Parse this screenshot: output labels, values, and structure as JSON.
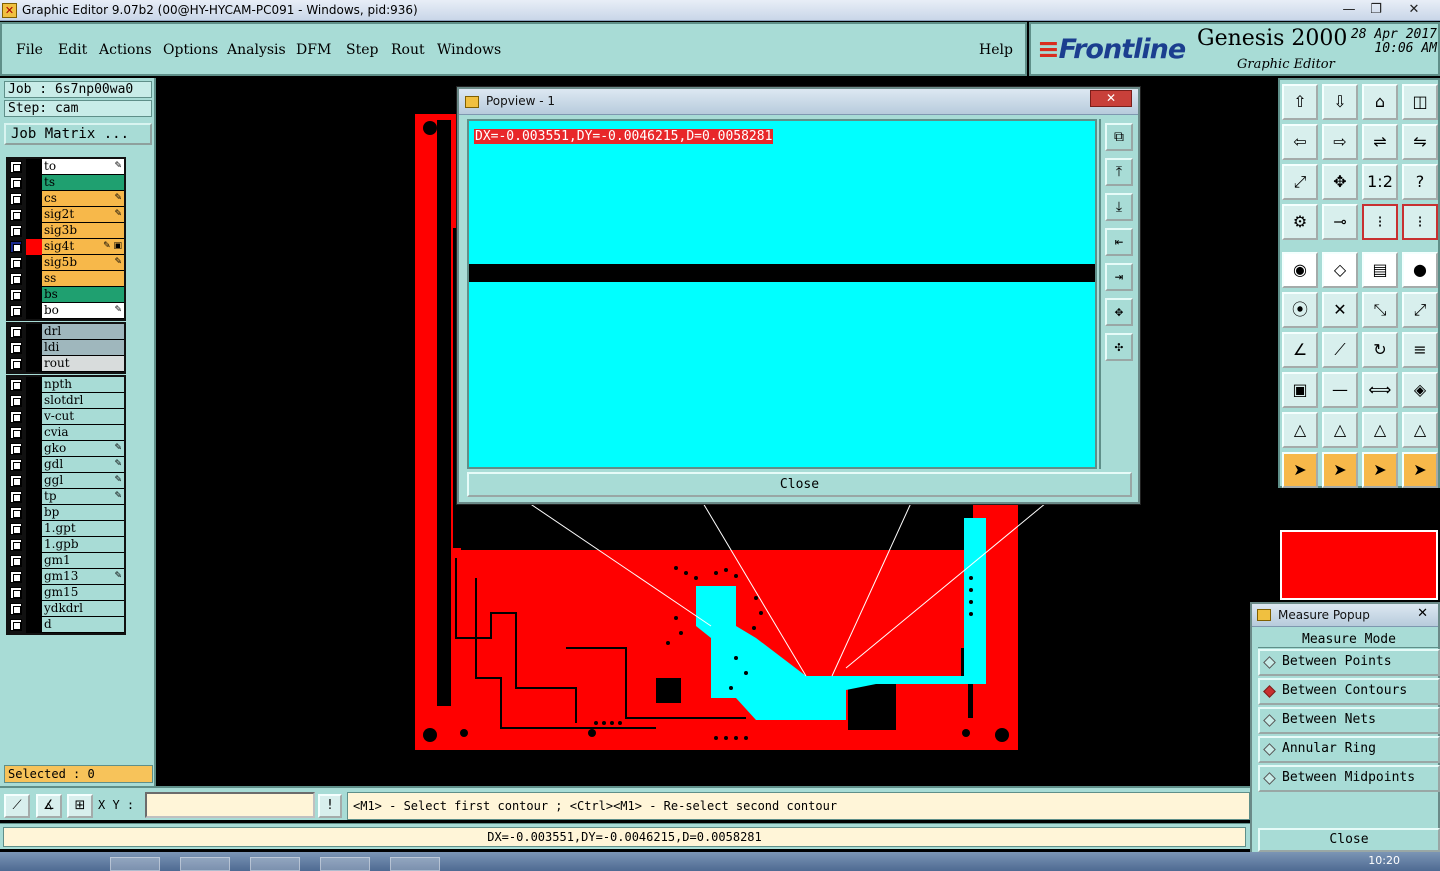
{
  "window": {
    "title": "Graphic Editor 9.07b2 (00@HY-HYCAM-PC091 - Windows, pid:936)",
    "minimize": "—",
    "maximize": "❐",
    "close": "✕"
  },
  "menu": {
    "items": [
      "File",
      "Edit",
      "Actions",
      "Options",
      "Analysis",
      "DFM",
      "Step",
      "Rout",
      "Windows"
    ],
    "help": "Help"
  },
  "brand": {
    "logo": "Frontline",
    "product": "Genesis 2000",
    "subtitle": "Graphic Editor",
    "date": "28 Apr 2017",
    "time": "10:06 AM"
  },
  "job": {
    "job_label": "Job : 6s7np00wa0",
    "step_label": "Step: cam",
    "matrix_button": "Job Matrix ..."
  },
  "layers": {
    "board": [
      {
        "name": "to",
        "color": "#ffffff",
        "flag": "✎"
      },
      {
        "name": "ts",
        "color": "#1fa070",
        "flag": ""
      },
      {
        "name": "cs",
        "color": "#f7b84a",
        "flag": "✎"
      },
      {
        "name": "sig2t",
        "color": "#f7b84a",
        "flag": "✎"
      },
      {
        "name": "sig3b",
        "color": "#f7b84a",
        "flag": ""
      },
      {
        "name": "sig4t",
        "color": "#f7b84a",
        "flag": "✎ ▣",
        "active": true
      },
      {
        "name": "sig5b",
        "color": "#f7b84a",
        "flag": "✎"
      },
      {
        "name": "ss",
        "color": "#f7b84a",
        "flag": ""
      },
      {
        "name": "bs",
        "color": "#1fa070",
        "flag": ""
      },
      {
        "name": "bo",
        "color": "#ffffff",
        "flag": "✎"
      }
    ],
    "drill": [
      {
        "name": "drl",
        "color": "#9fb7bd"
      },
      {
        "name": "ldi",
        "color": "#9fb7bd"
      },
      {
        "name": "rout",
        "color": "#d8dcdc"
      }
    ],
    "misc": [
      {
        "name": "npth",
        "flag": ""
      },
      {
        "name": "slotdrl",
        "flag": ""
      },
      {
        "name": "v-cut",
        "flag": ""
      },
      {
        "name": "cvia",
        "flag": ""
      },
      {
        "name": "gko",
        "flag": "✎"
      },
      {
        "name": "gdl",
        "flag": "✎"
      },
      {
        "name": "ggl",
        "flag": "✎"
      },
      {
        "name": "tp",
        "flag": "✎"
      },
      {
        "name": "bp",
        "flag": ""
      },
      {
        "name": "1.gpt",
        "flag": ""
      },
      {
        "name": "1.gpb",
        "flag": ""
      },
      {
        "name": "gm1",
        "flag": ""
      },
      {
        "name": "gm13",
        "flag": "✎"
      },
      {
        "name": "gm15",
        "flag": ""
      },
      {
        "name": "ydkdrl",
        "flag": ""
      },
      {
        "name": "d",
        "flag": ""
      }
    ],
    "misc_color": "#a8dcd6"
  },
  "selected": "Selected : 0",
  "popview": {
    "title": "Popview - 1",
    "close_x": "✕",
    "readout": "DX=-0.003551,DY=-0.0046215,D=0.0058281",
    "close_button": "Close",
    "tools": [
      "⧉",
      "⤒",
      "⤓",
      "⇤",
      "⇥",
      "✥",
      "✣"
    ]
  },
  "toolbar": {
    "rows": [
      [
        "⇧",
        "⇩",
        "⌂",
        "◫"
      ],
      [
        "⇦",
        "⇨",
        "⇌",
        "⇋"
      ],
      [
        "⤢",
        "✥",
        "1:2",
        "?"
      ],
      [
        "⚙",
        "⊸",
        "⁝",
        "⁝"
      ],
      [
        "◉",
        "◇",
        "▤",
        "●"
      ],
      [
        "⦿",
        "✕",
        "⤡",
        "⤢"
      ],
      [
        "∠",
        "⟋",
        "↻",
        "≡"
      ],
      [
        "▣",
        "—",
        "⟺",
        "◈"
      ],
      [
        "△",
        "△",
        "△",
        "△"
      ],
      [
        "➤",
        "➤",
        "➤",
        "➤"
      ]
    ]
  },
  "measure": {
    "title": "Measure Popup",
    "close_x": "✕",
    "mode_label": "Measure Mode",
    "options": [
      {
        "label": "Between Points",
        "on": false
      },
      {
        "label": "Between Contours",
        "on": true
      },
      {
        "label": "Between Nets",
        "on": false
      },
      {
        "label": "Annular Ring",
        "on": false
      },
      {
        "label": "Between Midpoints",
        "on": false
      }
    ],
    "close_button": "Close"
  },
  "cmd": {
    "xy_label": "X Y :",
    "xy_value": "",
    "alert_button": "!",
    "prompt": "<M1> - Select first contour ; <Ctrl><M1> - Re-select second contour"
  },
  "status": {
    "value": "DX=-0.003551,DY=-0.0046215,D=0.0058281"
  },
  "taskbar": {
    "clock": "10:20"
  }
}
